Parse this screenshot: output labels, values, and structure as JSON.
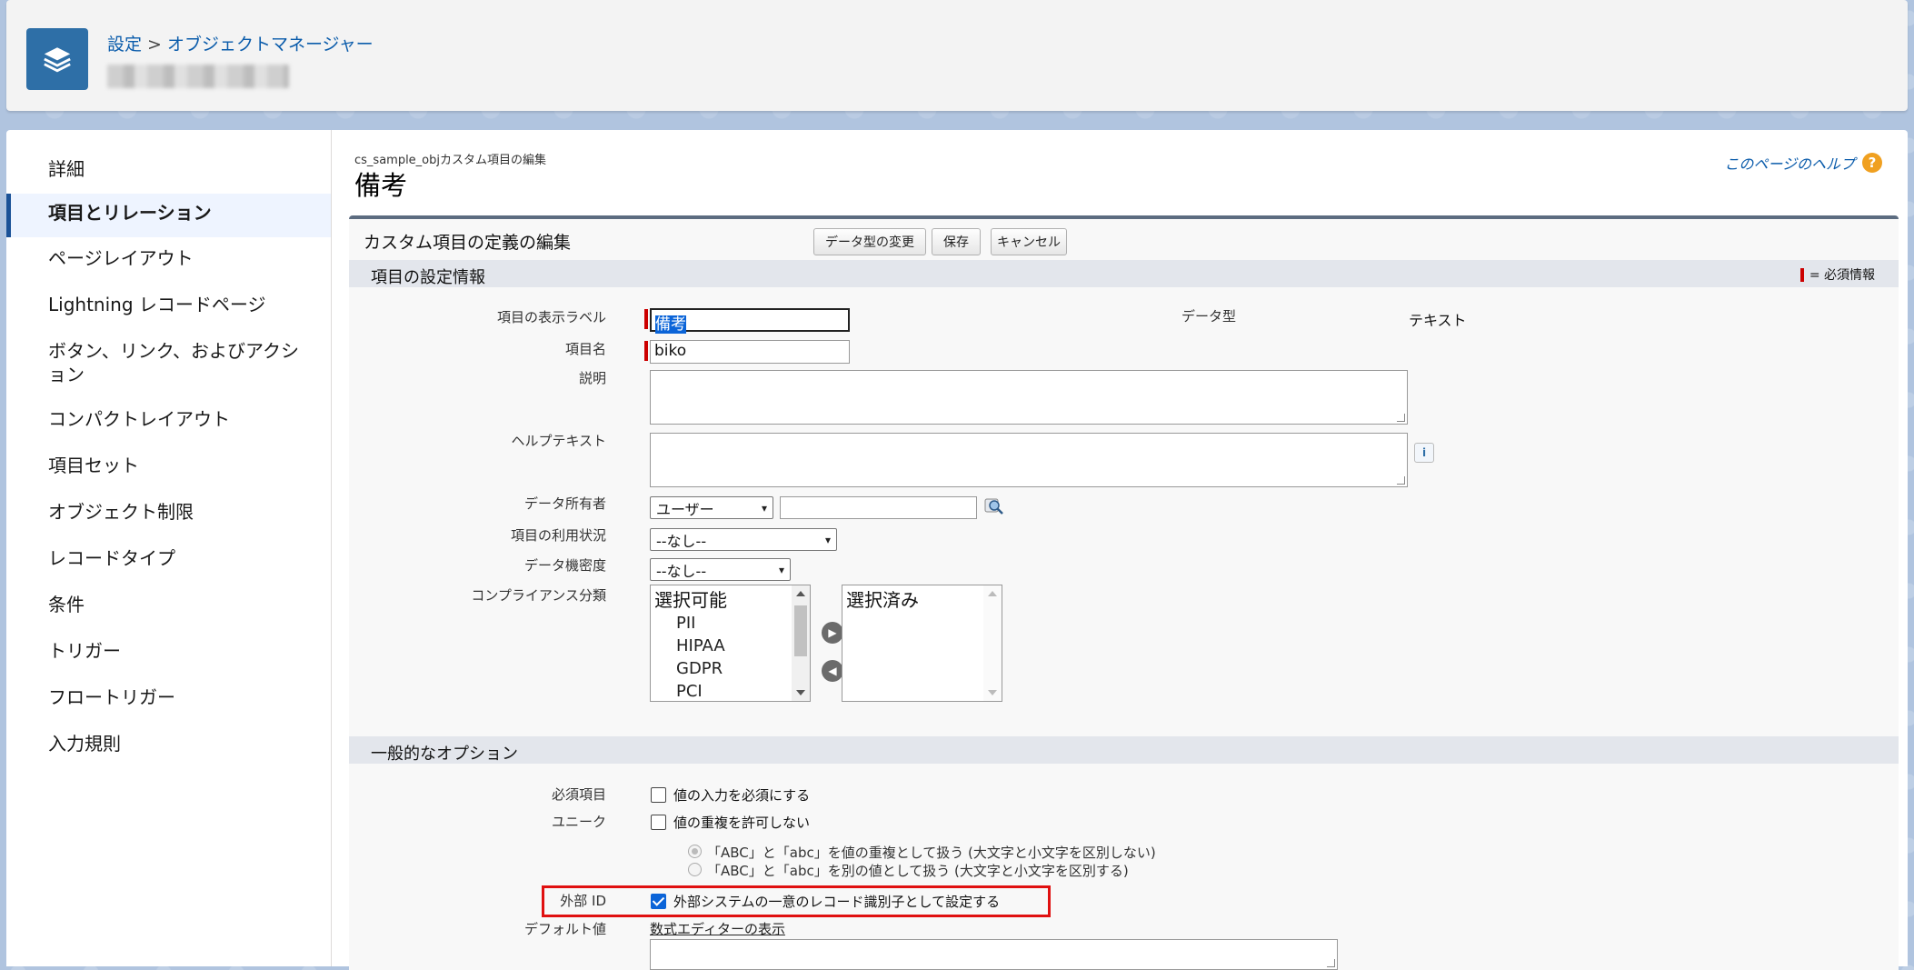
{
  "header": {
    "breadcrumb_root": "設定",
    "breadcrumb_sep": ">",
    "breadcrumb_current": "オブジェクトマネージャー"
  },
  "sidebar": {
    "items": [
      {
        "label": "詳細"
      },
      {
        "label": "項目とリレーション"
      },
      {
        "label": "ページレイアウト"
      },
      {
        "label": "Lightning レコードページ"
      },
      {
        "label": "ボタン、リンク、およびアクション"
      },
      {
        "label": "コンパクトレイアウト"
      },
      {
        "label": "項目セット"
      },
      {
        "label": "オブジェクト制限"
      },
      {
        "label": "レコードタイプ"
      },
      {
        "label": "条件"
      },
      {
        "label": "トリガー"
      },
      {
        "label": "フロートリガー"
      },
      {
        "label": "入力規則"
      }
    ],
    "active_index": 1
  },
  "page": {
    "subtitle": "cs_sample_objカスタム項目の編集",
    "title": "備考",
    "help_link": "このページのヘルプ",
    "help_icon": "?"
  },
  "panel": {
    "title": "カスタム項目の定義の編集",
    "buttons": {
      "change_type": "データ型の変更",
      "save": "保存",
      "cancel": "キャンセル"
    }
  },
  "field_settings": {
    "section_title": "項目の設定情報",
    "required_legend": "= 必須情報",
    "label_label": "項目の表示ラベル",
    "label_value": "備考",
    "name_label": "項目名",
    "name_value": "biko",
    "description_label": "説明",
    "help_text_label": "ヘルプテキスト",
    "data_type_label": "データ型",
    "data_type_value": "テキスト",
    "owner_label": "データ所有者",
    "owner_select": "ユーザー",
    "usage_label": "項目の利用状況",
    "usage_select": "--なし--",
    "sensitivity_label": "データ機密度",
    "sensitivity_select": "--なし--",
    "compliance_label": "コンプライアンス分類",
    "available_header": "選択可能",
    "available_options": [
      "PII",
      "HIPAA",
      "GDPR",
      "PCI"
    ],
    "selected_header": "選択済み"
  },
  "general_options": {
    "section_title": "一般的なオプション",
    "required_label": "必須項目",
    "required_text": "値の入力を必須にする",
    "required_checked": false,
    "unique_label": "ユニーク",
    "unique_text": "値の重複を許可しない",
    "unique_checked": false,
    "case_insensitive_text": "「ABC」と「abc」を値の重複として扱う (大文字と小文字を区別しない)",
    "case_sensitive_text": "「ABC」と「abc」を別の値として扱う (大文字と小文字を区別する)",
    "external_id_label": "外部 ID",
    "external_id_text": "外部システムの一意のレコード識別子として設定する",
    "external_id_checked": true,
    "default_label": "デフォルト値",
    "formula_link": "数式エディターの表示"
  }
}
